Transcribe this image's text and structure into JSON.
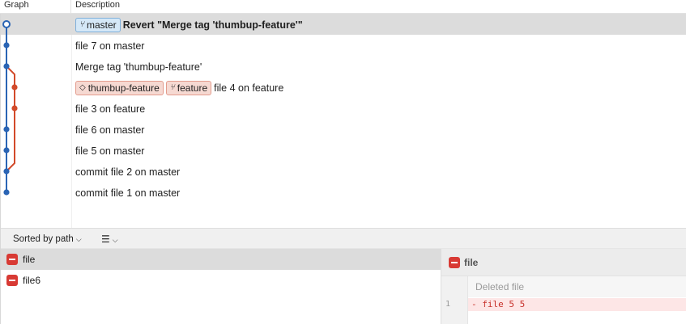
{
  "colors": {
    "master_line": "#2a64b4",
    "feature_line": "#d24a2a",
    "selected_row": "#dcdcdc",
    "deleted_icon": "#d83a34"
  },
  "log": {
    "header_graph": "Graph",
    "header_description": "Description",
    "rows": [
      {
        "message": "Revert \"Merge tag 'thumbup-feature'\"",
        "refs": [
          {
            "type": "branch",
            "label": "master",
            "color": "blue"
          }
        ]
      },
      {
        "message": "file 7 on master",
        "refs": []
      },
      {
        "message": "Merge tag 'thumbup-feature'",
        "refs": []
      },
      {
        "message": "file 4 on feature",
        "refs": [
          {
            "type": "tag",
            "label": "thumbup-feature",
            "color": "red"
          },
          {
            "type": "branch",
            "label": "feature",
            "color": "red"
          }
        ]
      },
      {
        "message": "file 3 on feature",
        "refs": []
      },
      {
        "message": "file 6 on master",
        "refs": []
      },
      {
        "message": "file 5 on master",
        "refs": []
      },
      {
        "message": "commit file 2 on master",
        "refs": []
      },
      {
        "message": "commit file 1 on master",
        "refs": []
      }
    ]
  },
  "toolbar": {
    "sort_label": "Sorted by path",
    "view_icon": "list-icon"
  },
  "files": [
    {
      "name": "file",
      "status": "deleted"
    },
    {
      "name": "file6",
      "status": "deleted"
    }
  ],
  "diff": {
    "file_name": "file",
    "hunk_label": "Deleted file",
    "lines": [
      {
        "number": "1",
        "text": "- file 5 5"
      }
    ]
  }
}
